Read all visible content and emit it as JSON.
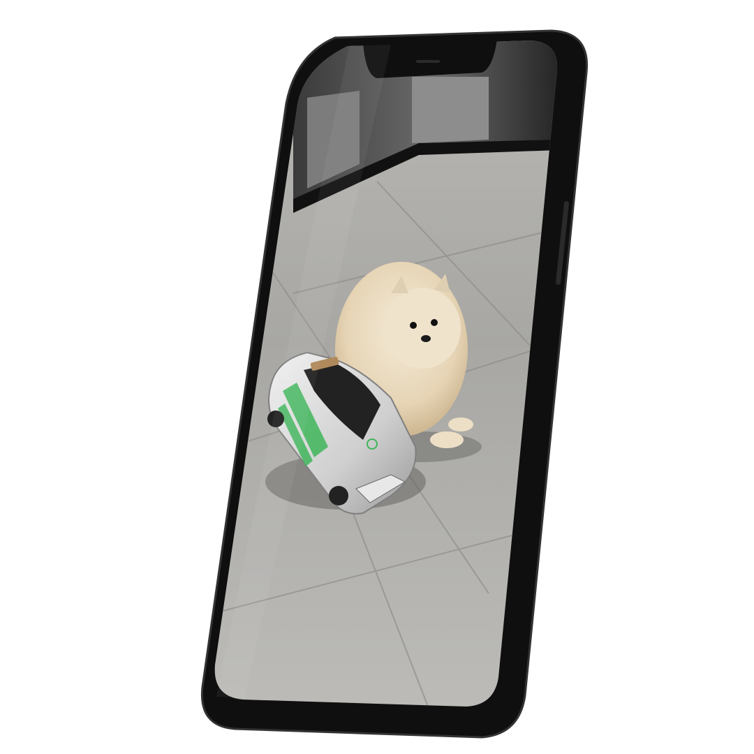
{
  "scene": {
    "subject": "phone-mockup",
    "colors": {
      "background": "#ffffff",
      "phone_body": "#141414",
      "phone_edge": "#2a2a2a",
      "floor": "#a9a8a4",
      "wall": "#2b2b2b",
      "dog_fur": "#eadcc4",
      "car_body": "#d9d9d9",
      "car_stripe": "#3fb55a"
    },
    "icons": {
      "camera_notch": "notch-icon",
      "car_logo": "car-logo-icon"
    }
  }
}
